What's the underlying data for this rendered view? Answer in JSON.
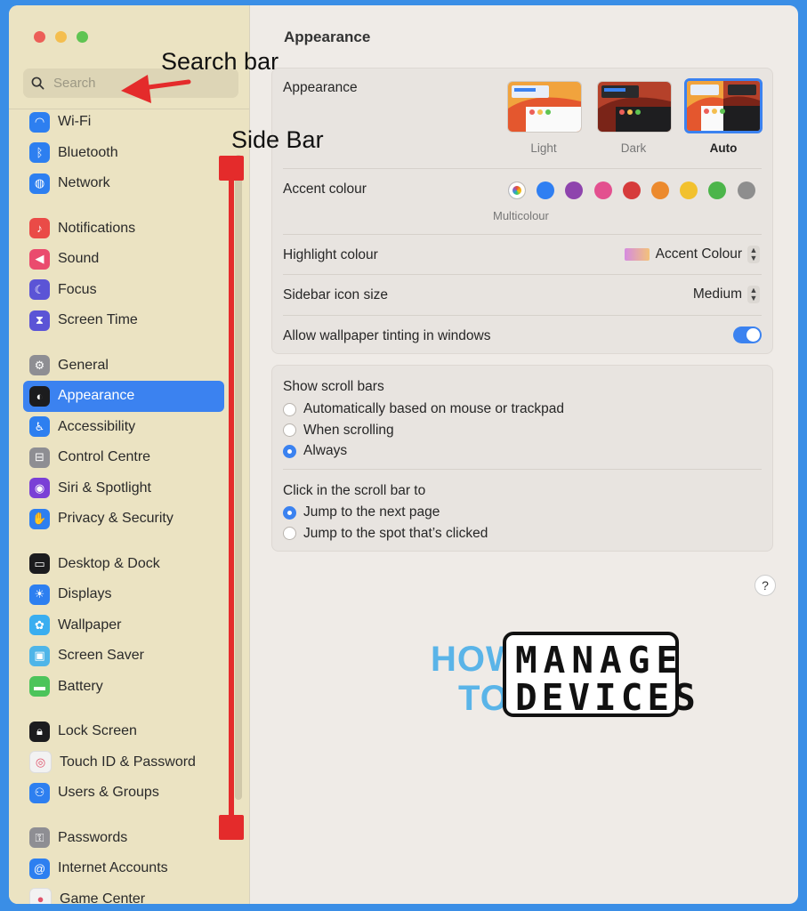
{
  "window": {
    "traffic_lights": {
      "close": "#ec5f58",
      "minimize": "#f4be4f",
      "zoom": "#5fc452"
    }
  },
  "search": {
    "placeholder": "Search",
    "icon": "magnifier-icon"
  },
  "sidebar": {
    "groups": [
      [
        {
          "label": "Wi-Fi",
          "icon": "wifi-icon",
          "color": "#2d7ff0"
        },
        {
          "label": "Bluetooth",
          "icon": "bluetooth-icon",
          "color": "#2d7ff0"
        },
        {
          "label": "Network",
          "icon": "globe-icon",
          "color": "#2d7ff0"
        }
      ],
      [
        {
          "label": "Notifications",
          "icon": "bell-icon",
          "color": "#ea4b47"
        },
        {
          "label": "Sound",
          "icon": "speaker-icon",
          "color": "#ea4b6e"
        },
        {
          "label": "Focus",
          "icon": "moon-icon",
          "color": "#5b54d6"
        },
        {
          "label": "Screen Time",
          "icon": "hourglass-icon",
          "color": "#5b54d6"
        }
      ],
      [
        {
          "label": "General",
          "icon": "gear-icon",
          "color": "#8e8e93"
        },
        {
          "label": "Appearance",
          "icon": "appearance-icon",
          "color": "#1c1c1e",
          "selected": true
        },
        {
          "label": "Accessibility",
          "icon": "accessibility-icon",
          "color": "#2d7ff0"
        },
        {
          "label": "Control Centre",
          "icon": "toggles-icon",
          "color": "#8e8e93"
        },
        {
          "label": "Siri & Spotlight",
          "icon": "siri-icon",
          "color": "#7a3fd6"
        },
        {
          "label": "Privacy & Security",
          "icon": "hand-icon",
          "color": "#2d7ff0"
        }
      ],
      [
        {
          "label": "Desktop & Dock",
          "icon": "dock-icon",
          "color": "#1c1c1e"
        },
        {
          "label": "Displays",
          "icon": "sun-icon",
          "color": "#2d7ff0"
        },
        {
          "label": "Wallpaper",
          "icon": "flower-icon",
          "color": "#3aaef0"
        },
        {
          "label": "Screen Saver",
          "icon": "screensaver-icon",
          "color": "#4fb5e8"
        },
        {
          "label": "Battery",
          "icon": "battery-icon",
          "color": "#4cc45a"
        }
      ],
      [
        {
          "label": "Lock Screen",
          "icon": "lock-icon",
          "color": "#1c1c1e"
        },
        {
          "label": "Touch ID & Password",
          "icon": "fingerprint-icon",
          "color": "#f2f2f2"
        },
        {
          "label": "Users & Groups",
          "icon": "users-icon",
          "color": "#2d7ff0"
        }
      ],
      [
        {
          "label": "Passwords",
          "icon": "key-icon",
          "color": "#8e8e93"
        },
        {
          "label": "Internet Accounts",
          "icon": "at-icon",
          "color": "#2d7ff0"
        },
        {
          "label": "Game Center",
          "icon": "gamecenter-icon",
          "color": "#f2f2f2"
        }
      ]
    ]
  },
  "annotations": {
    "search_bar": "Search bar",
    "side_bar": "Side Bar",
    "color": "#e42b2b"
  },
  "main": {
    "title": "Appearance",
    "appearance_label": "Appearance",
    "appearance_options": [
      {
        "label": "Light"
      },
      {
        "label": "Dark"
      },
      {
        "label": "Auto",
        "selected": true
      }
    ],
    "accent_label": "Accent colour",
    "accent_colors": [
      "multicolour",
      "#2f7ff2",
      "#8e44ad",
      "#e3508f",
      "#d63b3b",
      "#ec8a2e",
      "#f2c12e",
      "#4cb54a",
      "#8e8e8e"
    ],
    "accent_selected_name": "Multicolour",
    "highlight_label": "Highlight colour",
    "highlight_value": "Accent Colour",
    "sidebar_icon_label": "Sidebar icon size",
    "sidebar_icon_value": "Medium",
    "tinting_label": "Allow wallpaper tinting in windows",
    "tinting_on": true,
    "scroll_title": "Show scroll bars",
    "scroll_options": [
      {
        "label": "Automatically based on mouse or trackpad",
        "checked": false
      },
      {
        "label": "When scrolling",
        "checked": false
      },
      {
        "label": "Always",
        "checked": true
      }
    ],
    "click_title": "Click in the scroll bar to",
    "click_options": [
      {
        "label": "Jump to the next page",
        "checked": true
      },
      {
        "label": "Jump to the spot that’s clicked",
        "checked": false
      }
    ],
    "help": "?"
  },
  "logo": {
    "how": "HOW",
    "to": "TO",
    "manage": "MANAGE",
    "devices": "DEVICES"
  }
}
